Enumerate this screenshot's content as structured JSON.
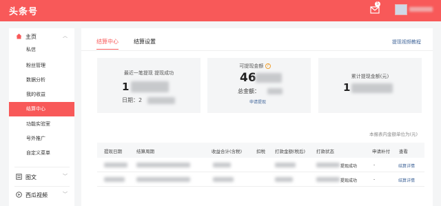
{
  "topbar": {
    "logo": "头条号",
    "msg_badge": "5"
  },
  "sidebar": {
    "sections": [
      {
        "label": "主页",
        "icon": "home-icon"
      },
      {
        "label": "图文",
        "icon": "article-icon"
      },
      {
        "label": "西瓜视频",
        "icon": "video-icon"
      }
    ],
    "items": [
      "私信",
      "粉丝管理",
      "数据分析",
      "我的收益",
      "结算中心",
      "功能实验室",
      "号外推广",
      "自定义菜单"
    ],
    "active_index": 4
  },
  "main": {
    "tabs": [
      "结算中心",
      "结算设置"
    ],
    "tutorial_link": "提现视频教程",
    "cards": {
      "c1": {
        "label": "最近一笔提现 提现成功",
        "value": "1",
        "date_label": "日期：2"
      },
      "c2": {
        "label": "可提现金额",
        "value": "46",
        "total_label": "总金额：",
        "link": "申请提现"
      },
      "c3": {
        "label": "累计提现金额(元)",
        "value": "1"
      }
    },
    "unit_note": "本报表内金额单位为(元)",
    "table": {
      "headers": [
        "提现日期",
        "结算周期",
        "收益合计(含税)",
        "扣税",
        "打款金额(税后)",
        "打款状态",
        "申请补付",
        "查看"
      ],
      "rows": [
        {
          "status": "提现成功",
          "supplement": "-",
          "view": "结算详情"
        },
        {
          "status": "提现成功",
          "supplement": "-",
          "view": "结算详情"
        }
      ]
    }
  },
  "colors": {
    "brand": "#f85959",
    "link": "#406599"
  }
}
